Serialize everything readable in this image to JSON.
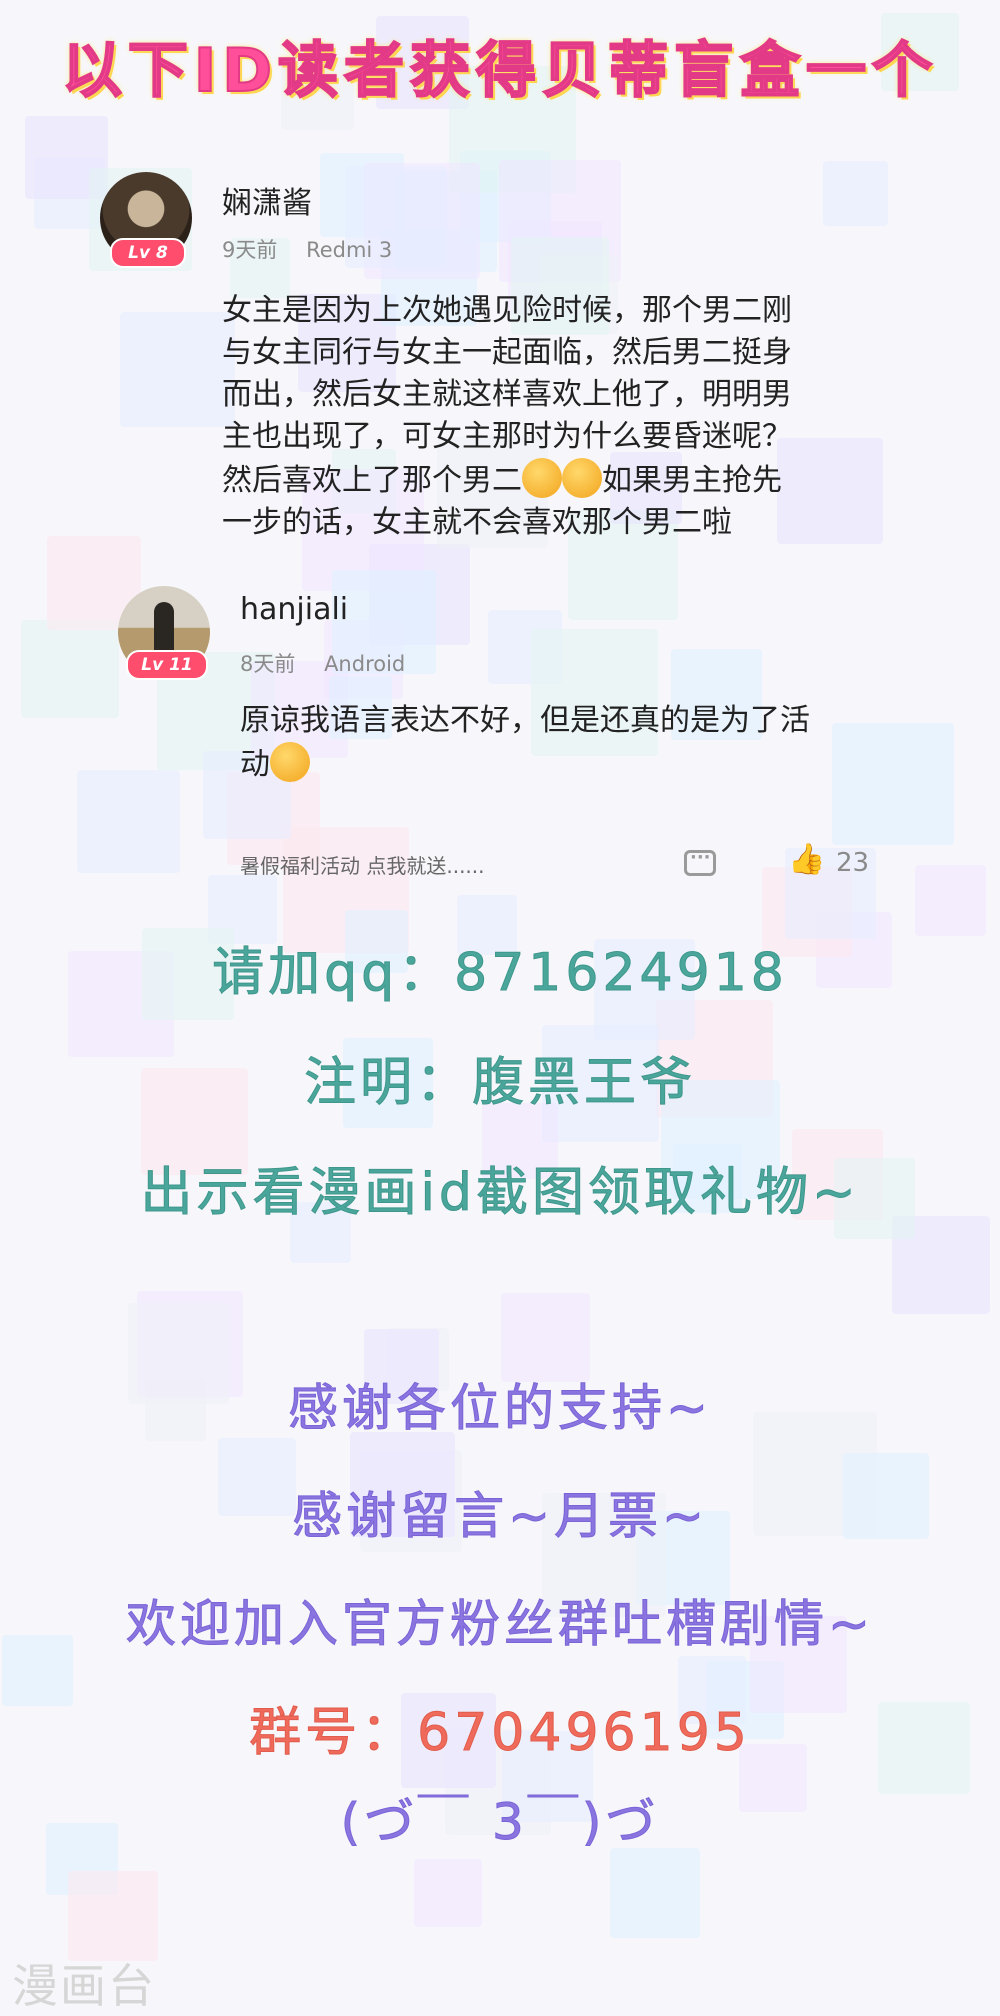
{
  "banner": {
    "title": "以下ID读者获得贝蒂盲盒一个"
  },
  "comment": {
    "username": "娴潇酱",
    "level": "Lv 8",
    "time": "9天前",
    "device": "Redmi 3",
    "lines": [
      "女主是因为上次她遇见险时候，那个男二刚",
      "与女主同行与女主一起面临，然后男二挺身",
      "而出，然后女主就这样喜欢上他了，明明男",
      "主也出现了，可女主那时为什么要昏迷呢？",
      "然后喜欢上了那个男二",
      "如果男主抢先",
      "一步的话，女主就不会喜欢那个男二啦"
    ]
  },
  "reply": {
    "username": "hanjiali",
    "level": "Lv 11",
    "time": "8天前",
    "device": "Android",
    "lines": [
      "原谅我语言表达不好，但是还真的是为了活",
      "动"
    ]
  },
  "footer": {
    "topic": "暑假福利活动 点我就送......",
    "like_count": "23",
    "icons": [
      "chat-icon",
      "thumbs-up-icon"
    ]
  },
  "promo": {
    "qq": "请加qq：871624918",
    "note": "注明：腹黑王爷",
    "show": "出示看漫画id截图领取礼物~"
  },
  "thanks": {
    "line1": "感谢各位的支持~",
    "line2": "感谢留言~月票~",
    "line3": "欢迎加入官方粉丝群吐槽剧情~",
    "group": "群号：670496195",
    "kaomoji": "(づ￣ 3￣)づ"
  },
  "watermark": "漫画台",
  "colors": {
    "banner_pink": "#ff4f9a",
    "teal": "#4aa59a",
    "purple": "#8a74e0",
    "coral": "#ef6a5a",
    "level_badge": "#ff4d6d"
  }
}
